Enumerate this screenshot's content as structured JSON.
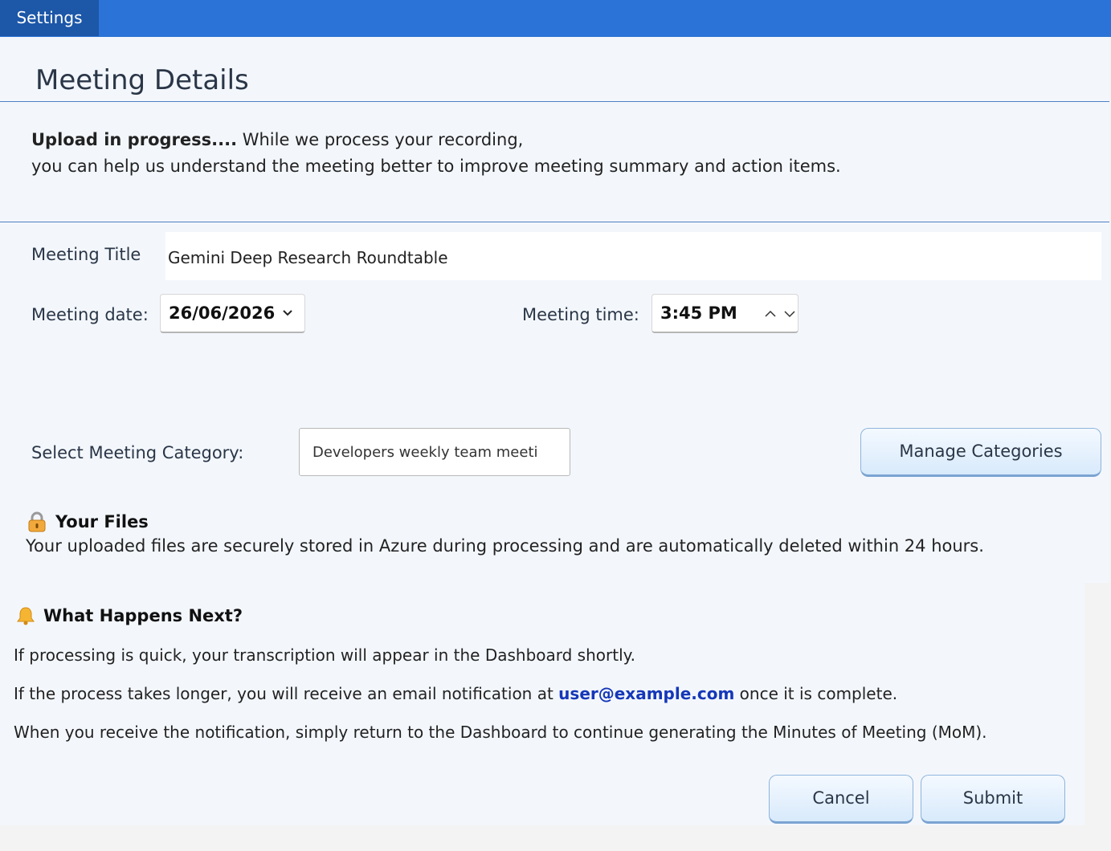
{
  "tab": {
    "label": "Settings"
  },
  "page": {
    "title": "Meeting Details"
  },
  "upload": {
    "bold": "Upload in progress....",
    "line1": " While we process your recording,",
    "line2": "you can help us understand the meeting better to improve meeting summary and action items."
  },
  "form": {
    "title_label": "Meeting Title",
    "title_value": "Gemini Deep Research Roundtable",
    "date_label": "Meeting date:",
    "date_value": "26/06/2026",
    "time_label": "Meeting time:",
    "time_value": "3:45 PM",
    "category_label": "Select Meeting Category:",
    "category_value": "Developers weekly team meeting",
    "manage_label": "Manage Categories"
  },
  "files": {
    "icon": "lock-icon",
    "heading": "Your Files",
    "text": "Your uploaded files are securely stored in Azure during processing and are automatically deleted within 24 hours."
  },
  "next": {
    "icon": "bell-icon",
    "heading": "What Happens Next?",
    "line1": "If processing is quick, your transcription will appear in the Dashboard shortly.",
    "line2_pre": "If the process takes longer, you will receive an email notification at ",
    "email": "user@example.com",
    "line2_post": " once it is complete.",
    "line3": "When you receive the notification, simply return to the Dashboard to continue generating the Minutes of Meeting (MoM)."
  },
  "buttons": {
    "cancel": "Cancel",
    "submit": "Submit"
  },
  "colors": {
    "topbar": "#2b73d6",
    "tab": "#1c57a8",
    "email": "#1537b8",
    "panel": "#f3f7fc"
  }
}
